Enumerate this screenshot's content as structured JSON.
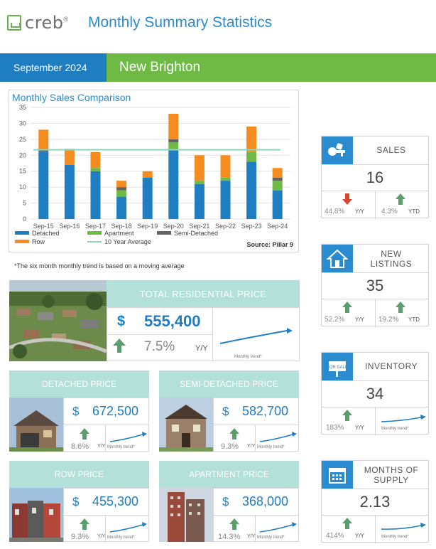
{
  "header": {
    "logo_text": "creb",
    "logo_reg": "®",
    "title": "Monthly Summary Statistics"
  },
  "strip": {
    "period": "September 2024",
    "community": "New Brighton"
  },
  "chart_data": {
    "type": "bar",
    "title": "Monthly Sales Comparison",
    "categories": [
      "Sep-15",
      "Sep-16",
      "Sep-17",
      "Sep-18",
      "Sep-19",
      "Sep-20",
      "Sep-21",
      "Sep-22",
      "Sep-23",
      "Sep-24"
    ],
    "series": [
      {
        "name": "Detached",
        "color": "#1f7dc2",
        "values": [
          21,
          17,
          15,
          7,
          13,
          22,
          11,
          12,
          18,
          9
        ]
      },
      {
        "name": "Apartment",
        "color": "#6fba45",
        "values": [
          0,
          0,
          1,
          2,
          0,
          2,
          1,
          1,
          3,
          3
        ]
      },
      {
        "name": "Semi-Detached",
        "color": "#646464",
        "values": [
          1,
          0,
          0,
          1,
          0,
          1,
          0,
          0,
          0,
          1
        ]
      },
      {
        "name": "Row",
        "color": "#f58c1f",
        "values": [
          6,
          5,
          5,
          2,
          2,
          8,
          8,
          7,
          8,
          3
        ]
      }
    ],
    "reference_line": {
      "name": "10 Year Average",
      "value": 21.7,
      "color": "#8fd3c1"
    },
    "ylim": [
      0,
      35
    ],
    "yticks": [
      0,
      5,
      10,
      15,
      20,
      25,
      30,
      35
    ],
    "grid": true,
    "legend": [
      {
        "label": "Detached",
        "color": "#1f7dc2"
      },
      {
        "label": "Apartment",
        "color": "#6fba45"
      },
      {
        "label": "Semi-Detached",
        "color": "#646464"
      },
      {
        "label": "Row",
        "color": "#f58c1f"
      },
      {
        "label": "10 Year Average",
        "color": "#8fd3c1"
      }
    ],
    "source": "Source: Pillar 9"
  },
  "footnote": "*The six month monthly trend is based on a moving average",
  "total_price": {
    "title": "TOTAL RESIDENTIAL PRICE",
    "dollar": "$",
    "value": "555,400",
    "pct": "7.5%",
    "yy": "Y/Y",
    "trend_label": "Monthly trend*"
  },
  "detached_price": {
    "title": "DETACHED PRICE",
    "dollar": "$",
    "value": "672,500",
    "pct": "8.6%",
    "yy": "Y/Y",
    "trend_label": "Monthly trend*"
  },
  "semi_price": {
    "title": "SEMI-DETACHED PRICE",
    "dollar": "$",
    "value": "582,700",
    "pct": "9.3%",
    "yy": "Y/Y",
    "trend_label": "Monthly trend*"
  },
  "row_price": {
    "title": "ROW PRICE",
    "dollar": "$",
    "value": "455,300",
    "pct": "9.3%",
    "yy": "Y/Y",
    "trend_label": "Monthly trend*"
  },
  "apartment_price": {
    "title": "APARTMENT PRICE",
    "dollar": "$",
    "value": "368,000",
    "pct": "14.3%",
    "yy": "Y/Y",
    "trend_label": "Monthly trend*"
  },
  "sales": {
    "title": "SALES",
    "value": "16",
    "yy_pct": "44.8%",
    "yy": "Y/Y",
    "ytd_pct": "4.3%",
    "ytd": "YTD",
    "icon": "key-icon"
  },
  "new_listings": {
    "title_line1": "NEW",
    "title_line2": "LISTINGS",
    "value": "35",
    "yy_pct": "52.2%",
    "yy": "Y/Y",
    "ytd_pct": "19.2%",
    "ytd": "YTD",
    "icon": "house-icon"
  },
  "inventory": {
    "title": "INVENTORY",
    "value": "34",
    "yy_pct": "183%",
    "yy": "Y/Y",
    "trend_label": "Monthly trend*",
    "icon": "for-sale-sign-icon",
    "sign_text": "FOR SALE"
  },
  "supply": {
    "title_line1": "MONTHS OF",
    "title_line2": "SUPPLY",
    "value": "2.13",
    "yy_pct": "414%",
    "yy": "Y/Y",
    "trend_label": "Monthly trend*",
    "icon": "calendar-icon"
  },
  "colors": {
    "blue": "#1f7dc2",
    "green": "#6fba45",
    "teal": "#b3e0d9",
    "arrow_green": "#5a9e6e",
    "arrow_red": "#d9452f"
  }
}
